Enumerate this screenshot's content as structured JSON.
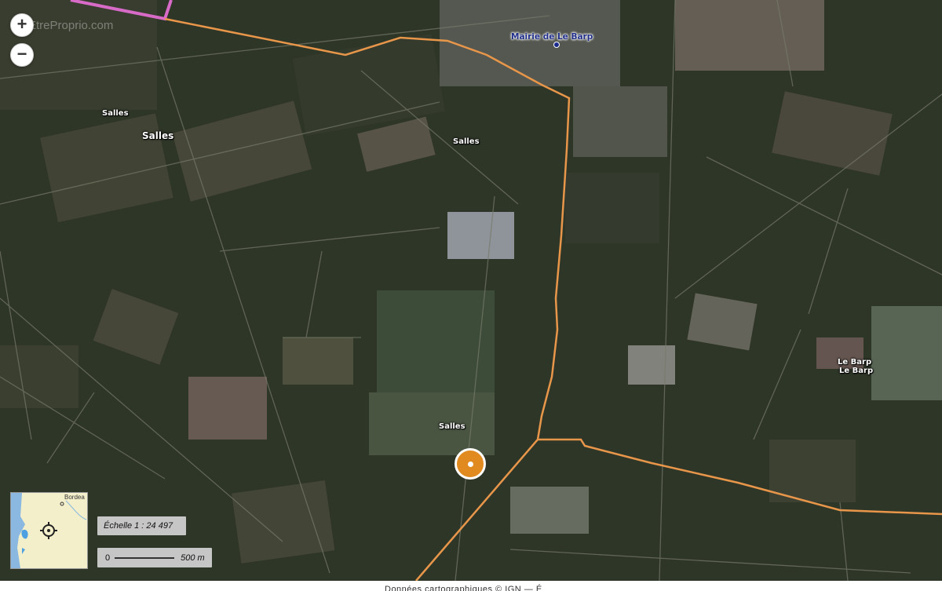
{
  "watermark": "EtreProprio.com",
  "zoom": {
    "in_label": "+",
    "out_label": "−"
  },
  "places": {
    "mairie": "Mairie de Le Barp",
    "salles_1": "Salles",
    "salles_2": "Salles",
    "salles_3": "Salles",
    "salles_4": "Salles",
    "le_barp_1": "Le Barp",
    "le_barp_2": "Le Barp"
  },
  "minimap": {
    "label": "Bordea"
  },
  "scale": {
    "ratio": "Échelle 1 : 24 497",
    "zero": "0",
    "distance": "500 m"
  },
  "footer": "Données cartographiques © IGN — É",
  "colors": {
    "route": "#e8964a",
    "boundary": "#d86ac8",
    "marker": "#e08a1f"
  },
  "icons": {
    "locate": "crosshair-icon",
    "marker": "property-location-marker"
  }
}
